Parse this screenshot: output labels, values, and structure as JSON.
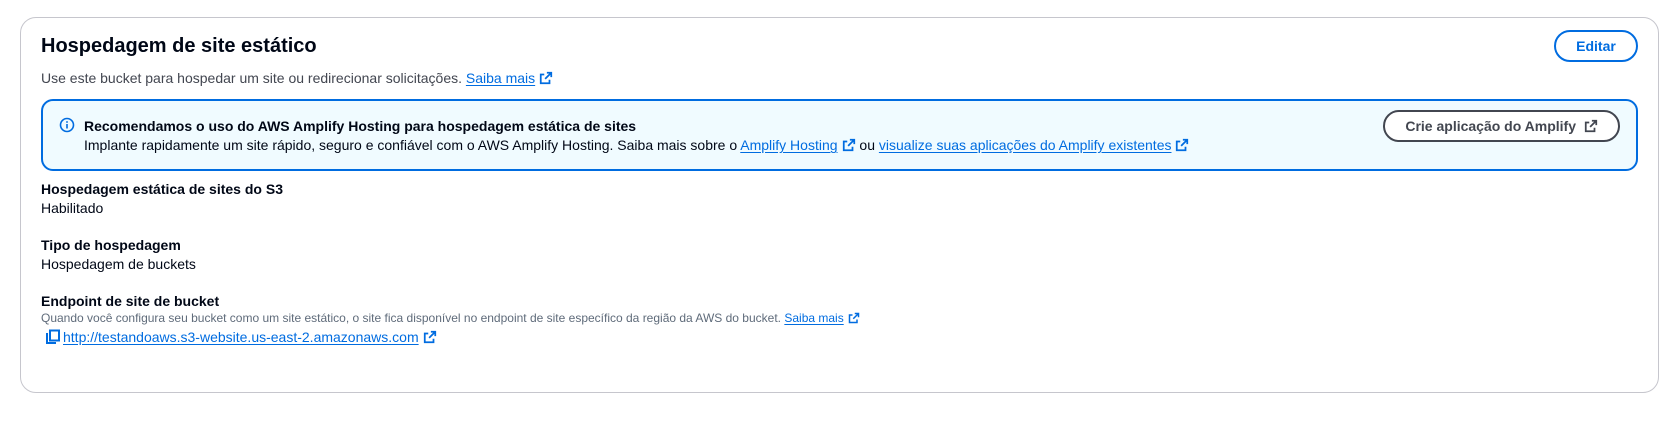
{
  "section": {
    "title": "Hospedagem de site estático",
    "description": "Use este bucket para hospedar um site ou redirecionar solicitações.",
    "learn_more": "Saiba mais",
    "edit_label": "Editar"
  },
  "alert": {
    "title": "Recomendamos o uso do AWS Amplify Hosting para hospedagem estática de sites",
    "body_prefix": "Implante rapidamente um site rápido, seguro e confiável com o AWS Amplify Hosting. Saiba mais sobre o",
    "link1": "Amplify Hosting",
    "connector": "ou",
    "link2": "visualize suas aplicações do Amplify existentes",
    "button_label": "Crie aplicação do Amplify"
  },
  "fields": {
    "s3_hosting": {
      "label": "Hospedagem estática de sites do S3",
      "value": "Habilitado"
    },
    "hosting_type": {
      "label": "Tipo de hospedagem",
      "value": "Hospedagem de buckets"
    },
    "endpoint": {
      "label": "Endpoint de site de bucket",
      "hint": "Quando você configura seu bucket como um site estático, o site fica disponível no endpoint de site específico da região da AWS do bucket.",
      "hint_link": "Saiba mais",
      "url": "http://testandoaws.s3-website.us-east-2.amazonaws.com"
    }
  },
  "colors": {
    "link": "#006ce0",
    "alert_bg": "#f0fbff",
    "border": "#c6c6cd",
    "text": "#000716"
  },
  "icons": [
    "external-link-icon",
    "info-icon",
    "copy-icon"
  ]
}
